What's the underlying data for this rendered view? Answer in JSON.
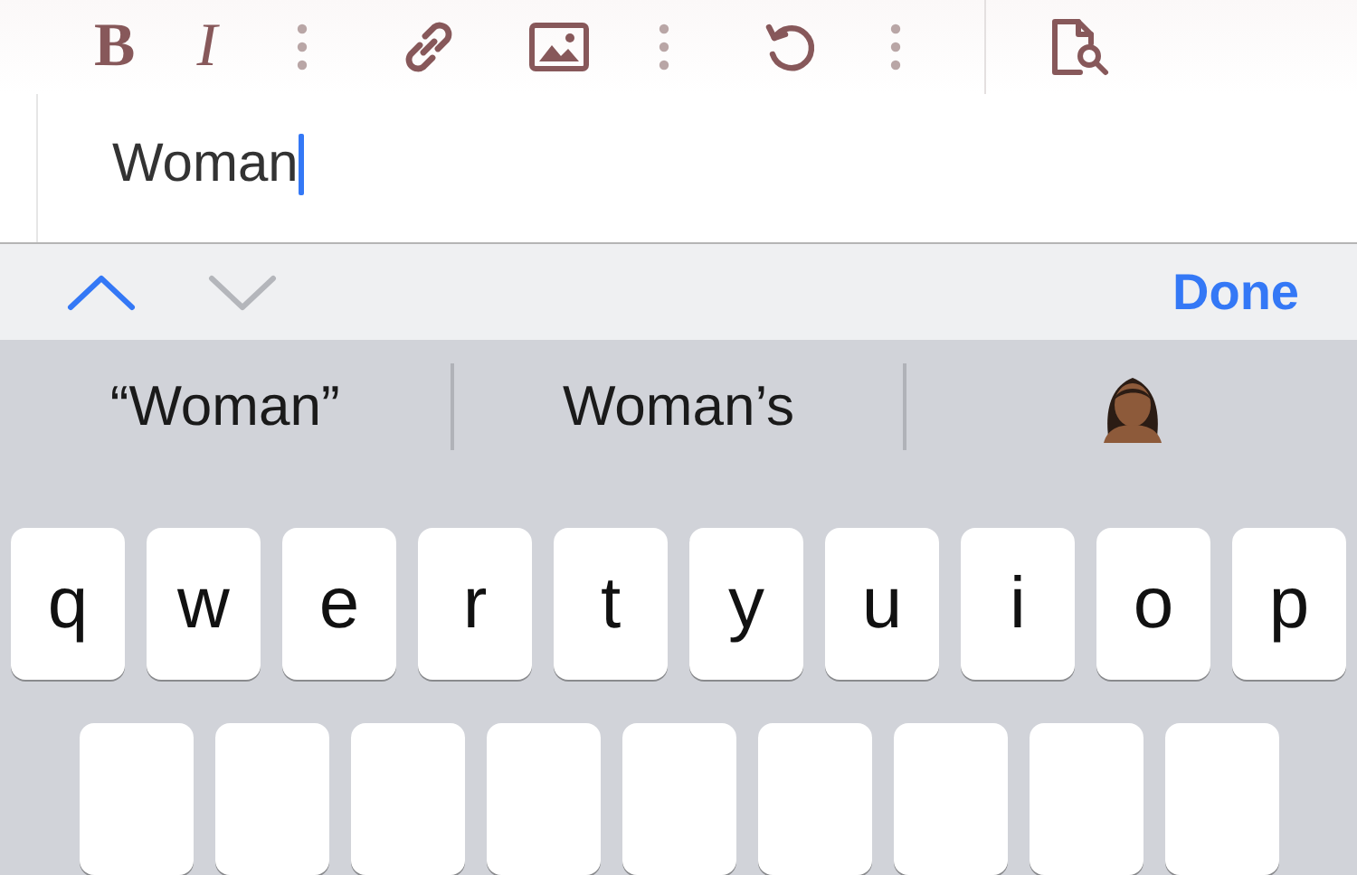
{
  "toolbar": {
    "items": [
      {
        "kind": "bold",
        "label": "B"
      },
      {
        "kind": "italic",
        "label": "I"
      },
      {
        "kind": "more"
      },
      {
        "kind": "link"
      },
      {
        "kind": "image"
      },
      {
        "kind": "more"
      },
      {
        "kind": "undo"
      },
      {
        "kind": "more"
      },
      {
        "kind": "preview"
      }
    ]
  },
  "editor": {
    "text": "Woman"
  },
  "accessory": {
    "nav": [
      {
        "kind": "up",
        "disabled": false
      },
      {
        "kind": "down",
        "disabled": true
      }
    ],
    "done": "Done"
  },
  "suggestions": [
    {
      "kind": "text",
      "label": "“Woman”"
    },
    {
      "kind": "text",
      "label": "Woman’s"
    },
    {
      "kind": "emoji"
    }
  ],
  "keys": [
    "q",
    "w",
    "e",
    "r",
    "t",
    "y",
    "u",
    "i",
    "o",
    "p"
  ]
}
